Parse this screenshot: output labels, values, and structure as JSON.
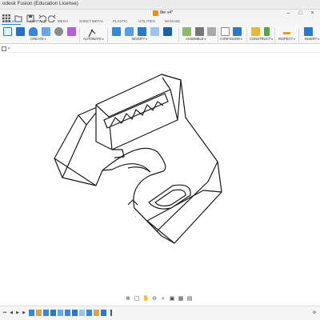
{
  "window": {
    "title": "odesk Fusion (Education License)"
  },
  "document": {
    "tab_label": "8te v4*"
  },
  "ribbon_tabs": [
    "SOLID",
    "SURFACE",
    "MESH",
    "SHEET METAL",
    "PLASTIC",
    "UTILITIES",
    "MANAGE"
  ],
  "active_tab": "SOLID",
  "groups": [
    "CREATE",
    "AUTOMATE",
    "MODIFY",
    "ASSEMBLE",
    "CONFIGURE",
    "CONSTRUCT",
    "INSPECT",
    "INSERT"
  ],
  "colors": {
    "accent": "#1a7fd0",
    "document_icon": "#f08c1a"
  },
  "icons": {
    "quick_access": [
      "app-grid-icon",
      "file-icon",
      "save-icon",
      "undo-icon",
      "redo-icon"
    ],
    "window_controls": [
      "minimize-icon",
      "maximize-icon",
      "close-icon"
    ]
  }
}
